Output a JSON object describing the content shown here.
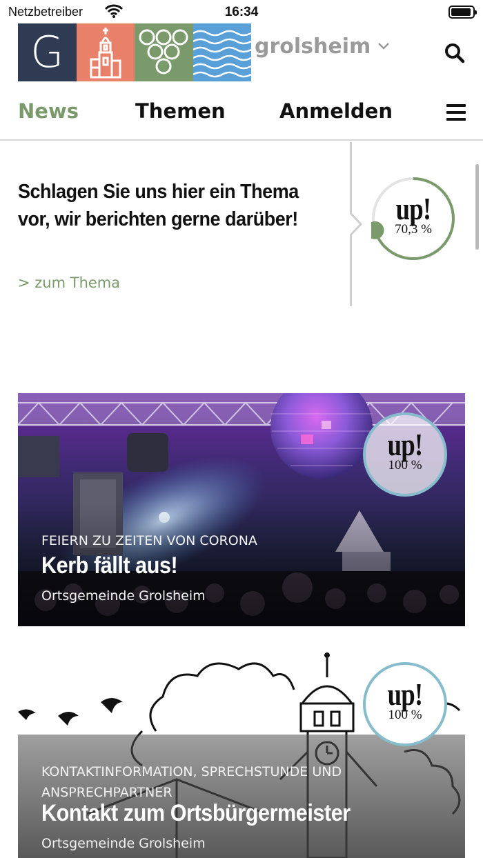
{
  "status_bar": {
    "carrier": "Netzbetreiber",
    "time": "16:34"
  },
  "header": {
    "logo_letter": "G",
    "town": "grolsheim"
  },
  "nav": {
    "items": [
      {
        "label": "News",
        "active": true
      },
      {
        "label": "Themen",
        "active": false
      },
      {
        "label": "Anmelden",
        "active": false
      }
    ]
  },
  "suggest": {
    "text": "Schlagen Sie uns hier ein Thema vor, wir berichten gerne darüber!",
    "link": "> zum Thema",
    "badge": {
      "word": "up!",
      "percent": "70,3 %",
      "progress": 0.703
    }
  },
  "cards": [
    {
      "category": "FEIERN ZU ZEITEN VON CORONA",
      "title": "Kerb fällt aus!",
      "source": "Ortsgemeinde Grolsheim",
      "badge": {
        "word": "up!",
        "percent": "100 %"
      }
    },
    {
      "category": "KONTAKTINFORMATION, SPRECHSTUNDE UND ANSPRECHPARTNER",
      "title": "Kontakt zum Ortsbürgermeister",
      "source": "Ortsgemeinde Grolsheim",
      "badge": {
        "word": "up!",
        "percent": "100 %"
      }
    }
  ],
  "colors": {
    "accent_green": "#7a9a6b",
    "logo_navy": "#2f3b52",
    "logo_salmon": "#e9806a",
    "logo_green": "#7a9a6b",
    "logo_blue": "#5aa0d8",
    "badge_ring_blue": "#86bccb"
  }
}
